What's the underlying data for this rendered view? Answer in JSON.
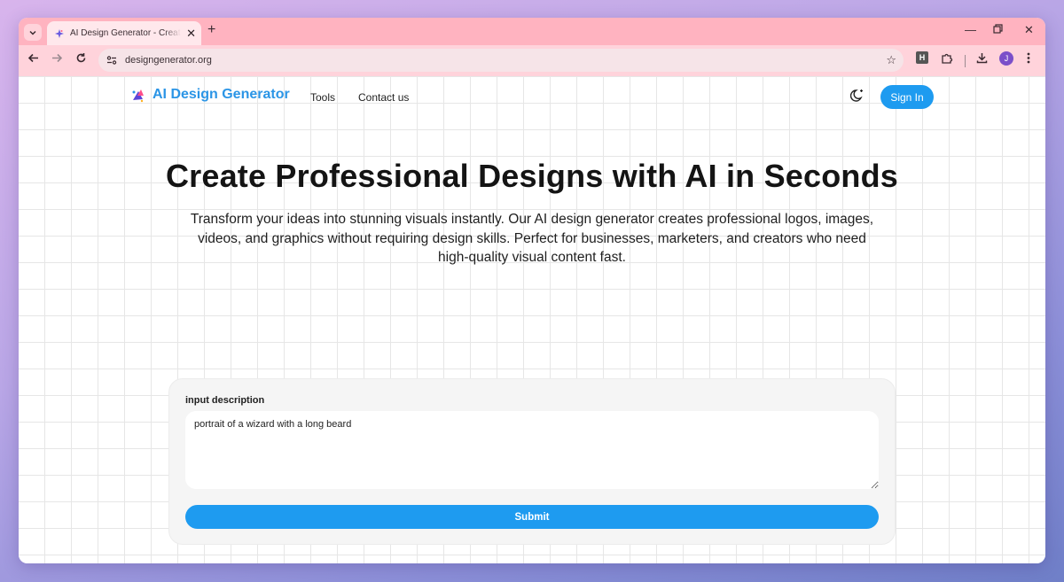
{
  "browser": {
    "tab_title": "AI Design Generator - Create Stunning Designs",
    "url": "designgenerator.org",
    "new_tab_label": "+",
    "profile_initial": "J",
    "extension_label": "H"
  },
  "header": {
    "logo_text": "AI Design Generator",
    "nav": [
      "Tools",
      "Contact us"
    ],
    "signin_label": "Sign In"
  },
  "hero": {
    "title": "Create Professional Designs with AI in Seconds",
    "subtitle": "Transform your ideas into stunning visuals instantly. Our AI design generator creates professional logos, images, videos, and graphics without requiring design skills. Perfect for businesses, marketers, and creators who need high-quality visual content fast."
  },
  "form": {
    "label": "input description",
    "value": "portrait of a wizard with a long beard",
    "submit_label": "Submit"
  },
  "colors": {
    "accent": "#1e9bf0",
    "tab_strip": "#ffb3c0",
    "toolbar": "#ffd3db"
  },
  "icons": {
    "tab_menu": "chevron-down-icon",
    "back": "arrow-left-icon",
    "forward": "arrow-right-icon",
    "reload": "reload-icon",
    "bookmark": "star-icon",
    "downloads": "download-icon",
    "menu": "kebab-menu-icon",
    "theme": "moon-sparkle-icon"
  }
}
